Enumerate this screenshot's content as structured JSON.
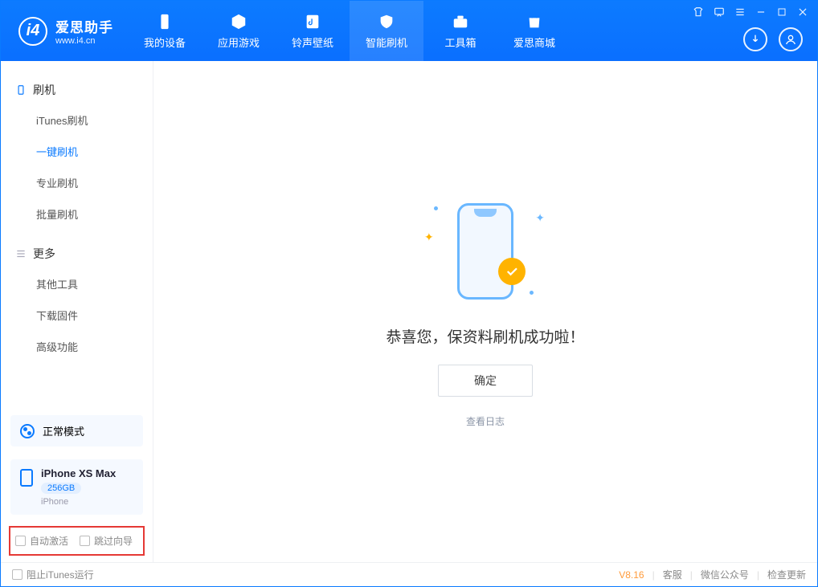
{
  "app": {
    "name": "爱思助手",
    "url": "www.i4.cn"
  },
  "tabs": {
    "device": "我的设备",
    "apps": "应用游戏",
    "ringtone": "铃声壁纸",
    "flash": "智能刷机",
    "toolbox": "工具箱",
    "store": "爱思商城"
  },
  "sidebar": {
    "section_flash_title": "刷机",
    "items_flash": {
      "itunes": "iTunes刷机",
      "oneclick": "一键刷机",
      "pro": "专业刷机",
      "batch": "批量刷机"
    },
    "section_more_title": "更多",
    "items_more": {
      "other": "其他工具",
      "download": "下载固件",
      "advanced": "高级功能"
    }
  },
  "mode_card": {
    "label": "正常模式"
  },
  "device_card": {
    "name": "iPhone XS Max",
    "capacity": "256GB",
    "type": "iPhone"
  },
  "options": {
    "auto_activate": "自动激活",
    "skip_guide": "跳过向导"
  },
  "main": {
    "success_text": "恭喜您，保资料刷机成功啦！",
    "ok_button": "确定",
    "view_log": "查看日志"
  },
  "footer": {
    "block_itunes": "阻止iTunes运行",
    "version": "V8.16",
    "support": "客服",
    "wechat": "微信公众号",
    "update": "检查更新"
  }
}
